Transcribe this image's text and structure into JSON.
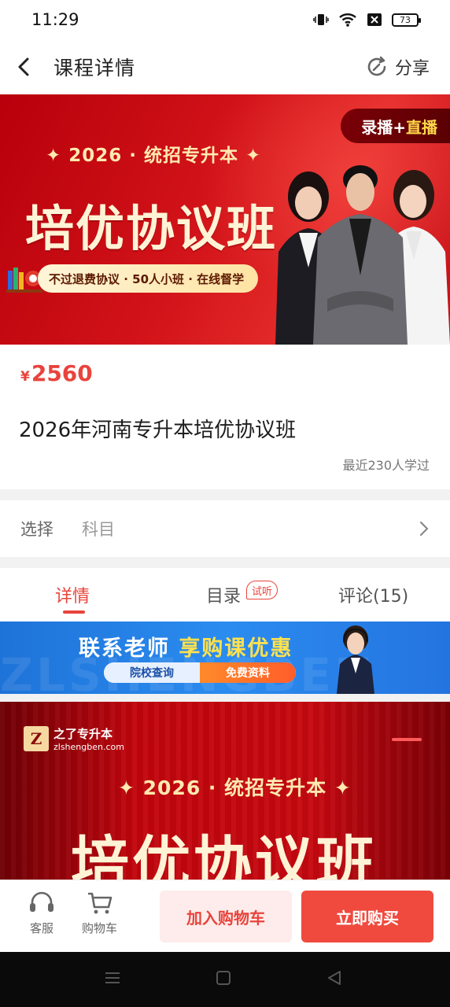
{
  "status_bar": {
    "time": "11:29",
    "battery": "73"
  },
  "header": {
    "title": "课程详情",
    "share_label": "分享"
  },
  "hero": {
    "tag_plain": "录播+",
    "tag_highlight": "直播",
    "year_line": "✦ 2026 · 统招专升本 ✦",
    "title": "培优协议班",
    "pill": "不过退费协议 · 50人小班 · 在线督学"
  },
  "course": {
    "currency": "¥",
    "price": "2560",
    "title": "2026年河南专升本培优协议班",
    "learners": "最近230人学过"
  },
  "select": {
    "label": "选择",
    "value": "科目"
  },
  "tabs": [
    {
      "label": "详情"
    },
    {
      "label": "目录"
    },
    {
      "label": "评论(15)"
    }
  ],
  "trial_badge": "试听",
  "contact_banner": {
    "watermark": "ZLSHENGBEN",
    "title_plain": "联系老师 ",
    "title_highlight": "享购课优惠",
    "btn_school": "院校查询",
    "btn_free": "免费资料"
  },
  "detail_banner": {
    "logo_name": "之了专升本",
    "logo_url": "zlshengben.com",
    "year_line": "✦ 2026 · 统招专升本 ✦",
    "title": "培优协议班"
  },
  "action_bar": {
    "service_label": "客服",
    "cart_label": "购物车",
    "add_cart": "加入购物车",
    "buy_now": "立即购买"
  },
  "colors": {
    "accent": "#e8443c",
    "hero_red": "#d21319",
    "banner_blue": "#2b8cf0"
  },
  "icons": [
    "back-arrow-icon",
    "share-icon",
    "chevron-right-icon",
    "headset-icon",
    "cart-icon"
  ]
}
